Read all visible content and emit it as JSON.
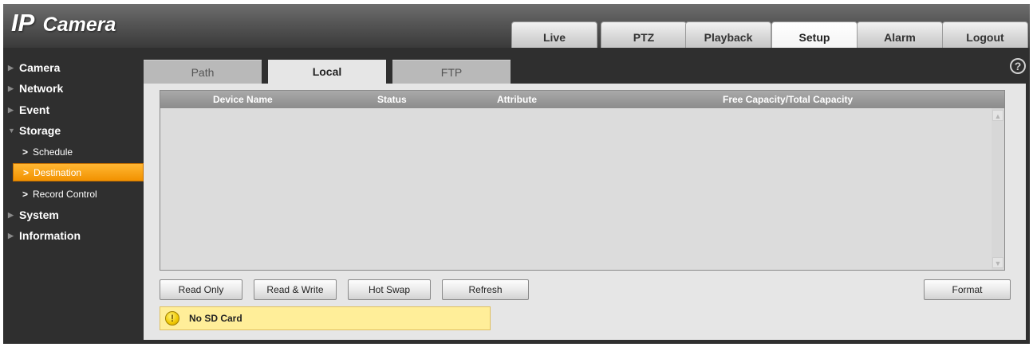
{
  "app": {
    "logo_ip": "IP",
    "logo_camera": "Camera"
  },
  "topnav": {
    "items": [
      {
        "label": "Live"
      },
      {
        "label": "PTZ"
      },
      {
        "label": "Playback"
      },
      {
        "label": "Setup",
        "active": true
      },
      {
        "label": "Alarm"
      },
      {
        "label": "Logout"
      }
    ]
  },
  "sidebar": {
    "camera": "Camera",
    "network": "Network",
    "event": "Event",
    "storage": "Storage",
    "schedule": "Schedule",
    "destination": "Destination",
    "record_control": "Record Control",
    "system": "System",
    "information": "Information"
  },
  "tabs": {
    "path": "Path",
    "local": "Local",
    "ftp": "FTP",
    "active": "Local"
  },
  "help": {
    "glyph": "?"
  },
  "table": {
    "columns": [
      "Device Name",
      "Status",
      "Attribute",
      "Free Capacity/Total Capacity"
    ],
    "rows": []
  },
  "buttons": {
    "read_only": "Read Only",
    "read_write": "Read & Write",
    "hot_swap": "Hot Swap",
    "refresh": "Refresh",
    "format": "Format"
  },
  "notice": {
    "icon_glyph": "!",
    "text": "No SD Card"
  },
  "colors": {
    "accent_active": "#f29200",
    "notice_background": "#ffee99"
  }
}
